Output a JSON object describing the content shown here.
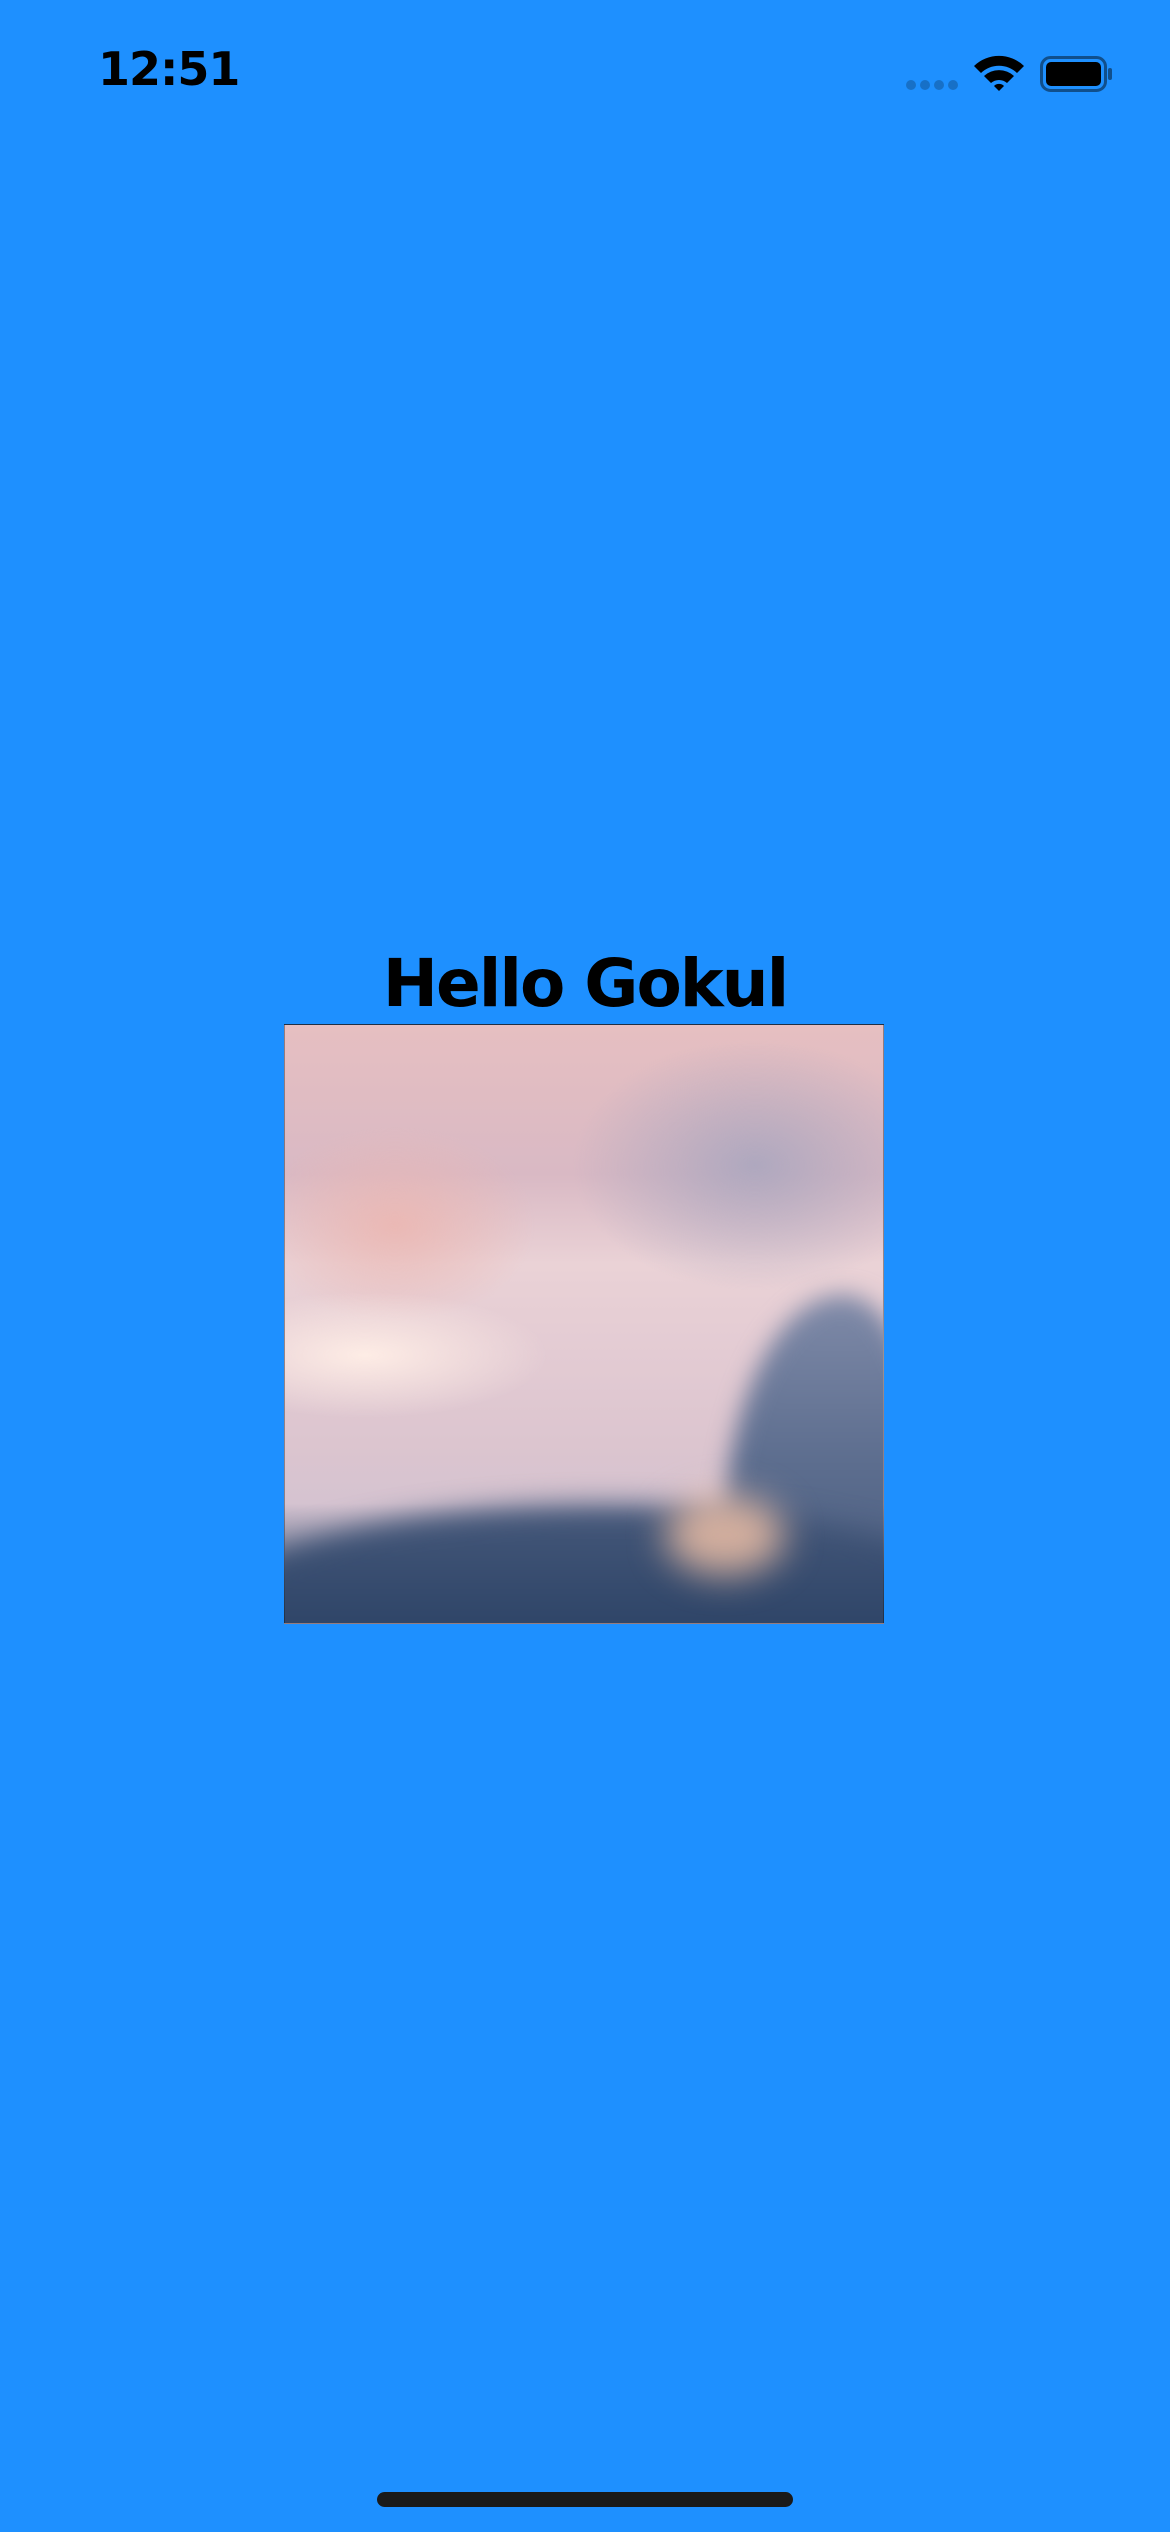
{
  "status_bar": {
    "time": "12:51",
    "icons": [
      "cellular-signal-icon",
      "wifi-icon",
      "battery-icon"
    ]
  },
  "main": {
    "greeting": "Hello Gokul"
  },
  "colors": {
    "background": "#1e90ff",
    "text": "#000000",
    "home_indicator": "#1a1a1a"
  }
}
